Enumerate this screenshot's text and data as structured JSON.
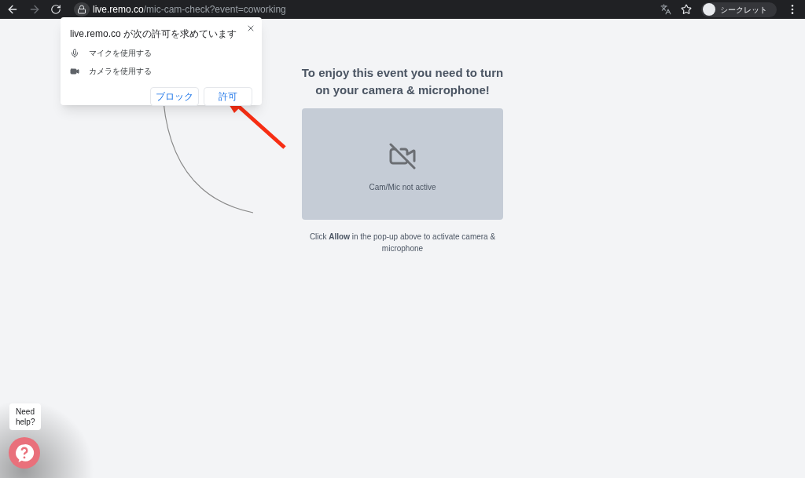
{
  "browser": {
    "url_host": "live.remo.co",
    "url_path": "/mic-cam-check?event=coworking",
    "profile_label": "シークレット"
  },
  "permission_popup": {
    "title": "live.remo.co が次の許可を求めています",
    "permissions": [
      {
        "kind": "mic",
        "label": "マイクを使用する"
      },
      {
        "kind": "camera",
        "label": "カメラを使用する"
      }
    ],
    "buttons": [
      "ブロック",
      "許可"
    ]
  },
  "main": {
    "heading": "To enjoy this event you need to turn on your camera & microphone!",
    "preview_status": "Cam/Mic not active",
    "instruction": "Click **Allow** in the pop-up above to activate camera & microphone"
  },
  "help": {
    "tooltip": "Need help?"
  }
}
